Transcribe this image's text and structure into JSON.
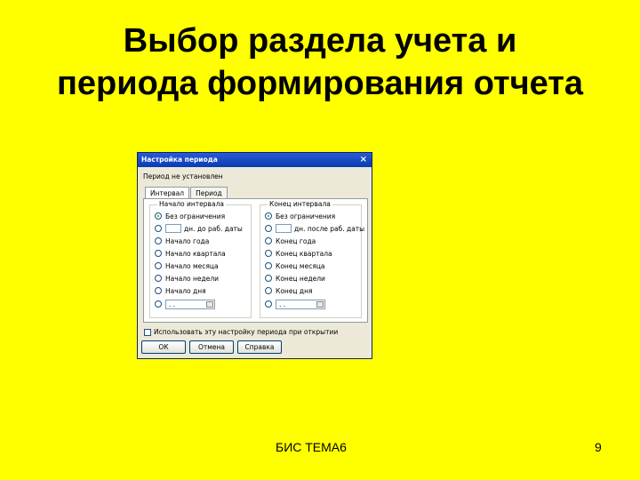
{
  "slide": {
    "title_line1": "Выбор раздела учета и",
    "title_line2": "периода формирования отчета",
    "footer_text": "БИС ТЕМА6",
    "page_number": "9",
    "background_color": "#ffff00"
  },
  "dialog": {
    "title": "Настройка периода",
    "close_label": "×",
    "status": "Период не установлен",
    "tabs": [
      "Интервал",
      "Период"
    ],
    "start_group": {
      "title": "Начало интервала",
      "options": [
        "Без ограничения",
        "дн. до раб. даты",
        "Начало года",
        "Начало квартала",
        "Начало месяца",
        "Начало недели",
        "Начало дня",
        "  .  ."
      ]
    },
    "end_group": {
      "title": "Конец интервала",
      "options": [
        "Без ограничения",
        "дн. после раб. даты",
        "Конец года",
        "Конец квартала",
        "Конец месяца",
        "Конец недели",
        "Конец дня",
        "  .  ."
      ]
    },
    "checkbox_label": "Использовать эту настройку периода при открытии",
    "buttons": {
      "ok": "ОК",
      "cancel": "Отмена",
      "help": "Справка"
    }
  }
}
